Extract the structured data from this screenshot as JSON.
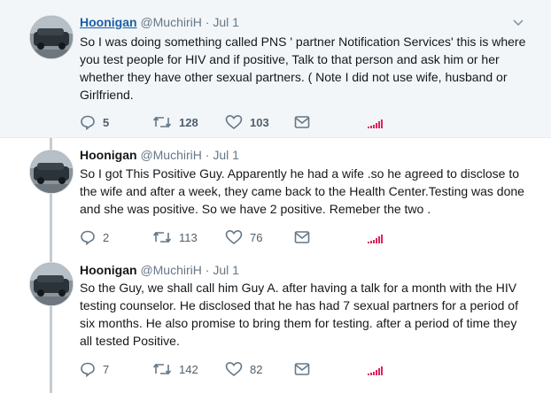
{
  "tweets": [
    {
      "name": "Hoonigan",
      "handle": "@MuchiriH",
      "separator": "·",
      "date": "Jul 1",
      "text": "So I was doing something called PNS ' partner Notification Services' this is where you test people for HIV and if positive, Talk to that person and ask him or her whether they have other sexual partners. ( Note I did not use wife, husband or Girlfriend.",
      "replies": "5",
      "retweets": "128",
      "likes": "103"
    },
    {
      "name": "Hoonigan",
      "handle": "@MuchiriH",
      "separator": "·",
      "date": "Jul 1",
      "text": "So I got This Positive Guy. Apparently he had a wife .so he agreed to disclose to the wife and after a week, they came back to the Health Center.Testing was done and she was positive. So we have 2 positive. Remeber the two .",
      "replies": "2",
      "retweets": "113",
      "likes": "76"
    },
    {
      "name": "Hoonigan",
      "handle": "@MuchiriH",
      "separator": "·",
      "date": "Jul 1",
      "text": "So the Guy, we shall call him Guy A.  after having a talk for a month with the  HIV testing counselor. He disclosed that  he has had  7 sexual partners  for a period of six months.  He also promise to bring them for testing. after a period of time they all tested Positive.",
      "replies": "7",
      "retweets": "142",
      "likes": "82"
    }
  ],
  "colors": {
    "name_link": "#1b5fa8",
    "secondary": "#657786",
    "analytics": "#e0245e",
    "thread_line": "#c4cbd1",
    "highlight_bg": "#f3f6f9"
  },
  "icons": [
    "reply-icon",
    "retweet-icon",
    "like-icon",
    "dm-icon",
    "analytics-icon",
    "chevron-down-icon"
  ]
}
